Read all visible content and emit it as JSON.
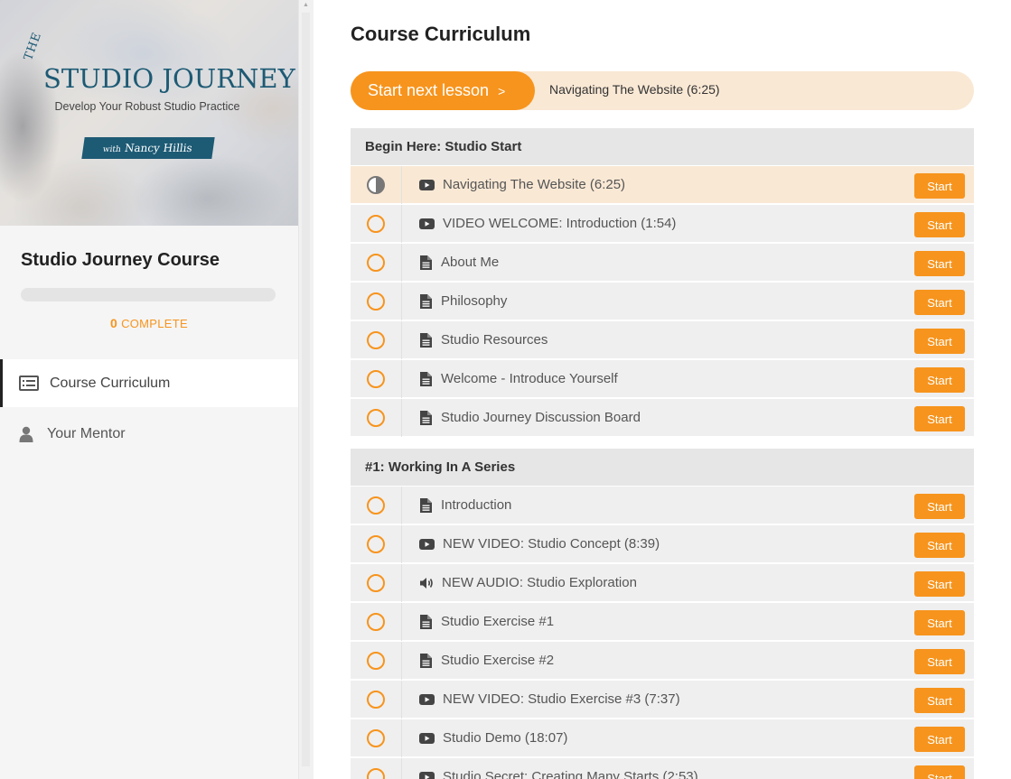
{
  "sidebar": {
    "banner": {
      "prefix": "THE",
      "title": "STUDIO JOURNEY",
      "subtitle": "Develop Your Robust Studio Practice",
      "with_label": "with",
      "author": "Nancy Hillis"
    },
    "course_title": "Studio Journey Course",
    "progress": {
      "value": "0",
      "label": "COMPLETE",
      "percent": 0
    },
    "nav": {
      "curriculum": "Course Curriculum",
      "mentor": "Your Mentor"
    }
  },
  "main": {
    "title": "Course Curriculum",
    "cta": {
      "button_label": "Start next lesson",
      "chevron": ">",
      "next_lesson": "Navigating The Website (6:25)"
    },
    "start_label": "Start",
    "sections": [
      {
        "title": "Begin Here: Studio Start",
        "lessons": [
          {
            "title": "Navigating The Website (6:25)",
            "type": "video",
            "status": "in-progress"
          },
          {
            "title": "VIDEO WELCOME: Introduction (1:54)",
            "type": "video",
            "status": "not-started"
          },
          {
            "title": "About Me",
            "type": "doc",
            "status": "not-started"
          },
          {
            "title": "Philosophy",
            "type": "doc",
            "status": "not-started"
          },
          {
            "title": "Studio Resources",
            "type": "doc",
            "status": "not-started"
          },
          {
            "title": "Welcome - Introduce Yourself",
            "type": "doc",
            "status": "not-started"
          },
          {
            "title": "Studio Journey Discussion Board",
            "type": "doc",
            "status": "not-started"
          }
        ]
      },
      {
        "title": "#1: Working In A Series",
        "lessons": [
          {
            "title": "Introduction",
            "type": "doc",
            "status": "not-started"
          },
          {
            "title": "NEW VIDEO: Studio Concept (8:39)",
            "type": "video",
            "status": "not-started"
          },
          {
            "title": "NEW AUDIO: Studio Exploration",
            "type": "audio",
            "status": "not-started"
          },
          {
            "title": "Studio Exercise #1",
            "type": "doc",
            "status": "not-started"
          },
          {
            "title": "Studio Exercise #2",
            "type": "doc",
            "status": "not-started"
          },
          {
            "title": "NEW VIDEO: Studio Exercise #3 (7:37)",
            "type": "video",
            "status": "not-started"
          },
          {
            "title": "Studio Demo (18:07)",
            "type": "video",
            "status": "not-started"
          },
          {
            "title": "Studio Secret: Creating Many Starts (2:53)",
            "type": "video",
            "status": "not-started"
          }
        ]
      }
    ]
  },
  "colors": {
    "accent": "#f7941d",
    "accent_light": "#f9e8d4",
    "row_bg": "#efefef",
    "header_bg": "#e6e6e6",
    "brand_blue": "#1d5a74"
  }
}
